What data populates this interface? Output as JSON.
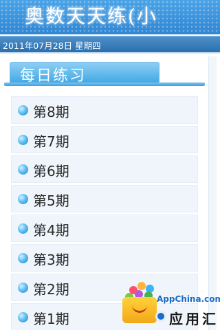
{
  "header": {
    "title": "奥数天天练(小"
  },
  "date_bar": {
    "date": "2011年07月28日 星期四"
  },
  "section_tab": {
    "label": "每日练习"
  },
  "issues": [
    {
      "label": "第8期"
    },
    {
      "label": "第7期"
    },
    {
      "label": "第6期"
    },
    {
      "label": "第5期"
    },
    {
      "label": "第4期"
    },
    {
      "label": "第3期"
    },
    {
      "label": "第2期"
    },
    {
      "label": "第1期"
    }
  ],
  "watermark": {
    "site": "AppChina.com",
    "brand": "应用汇"
  },
  "colors": {
    "header_blue": "#3a93dc",
    "date_bar_blue": "#2f76b6",
    "tab_blue": "#3da7e3",
    "item_bg": "#f0f5fb",
    "bullet_blue": "#3aa6e8"
  }
}
